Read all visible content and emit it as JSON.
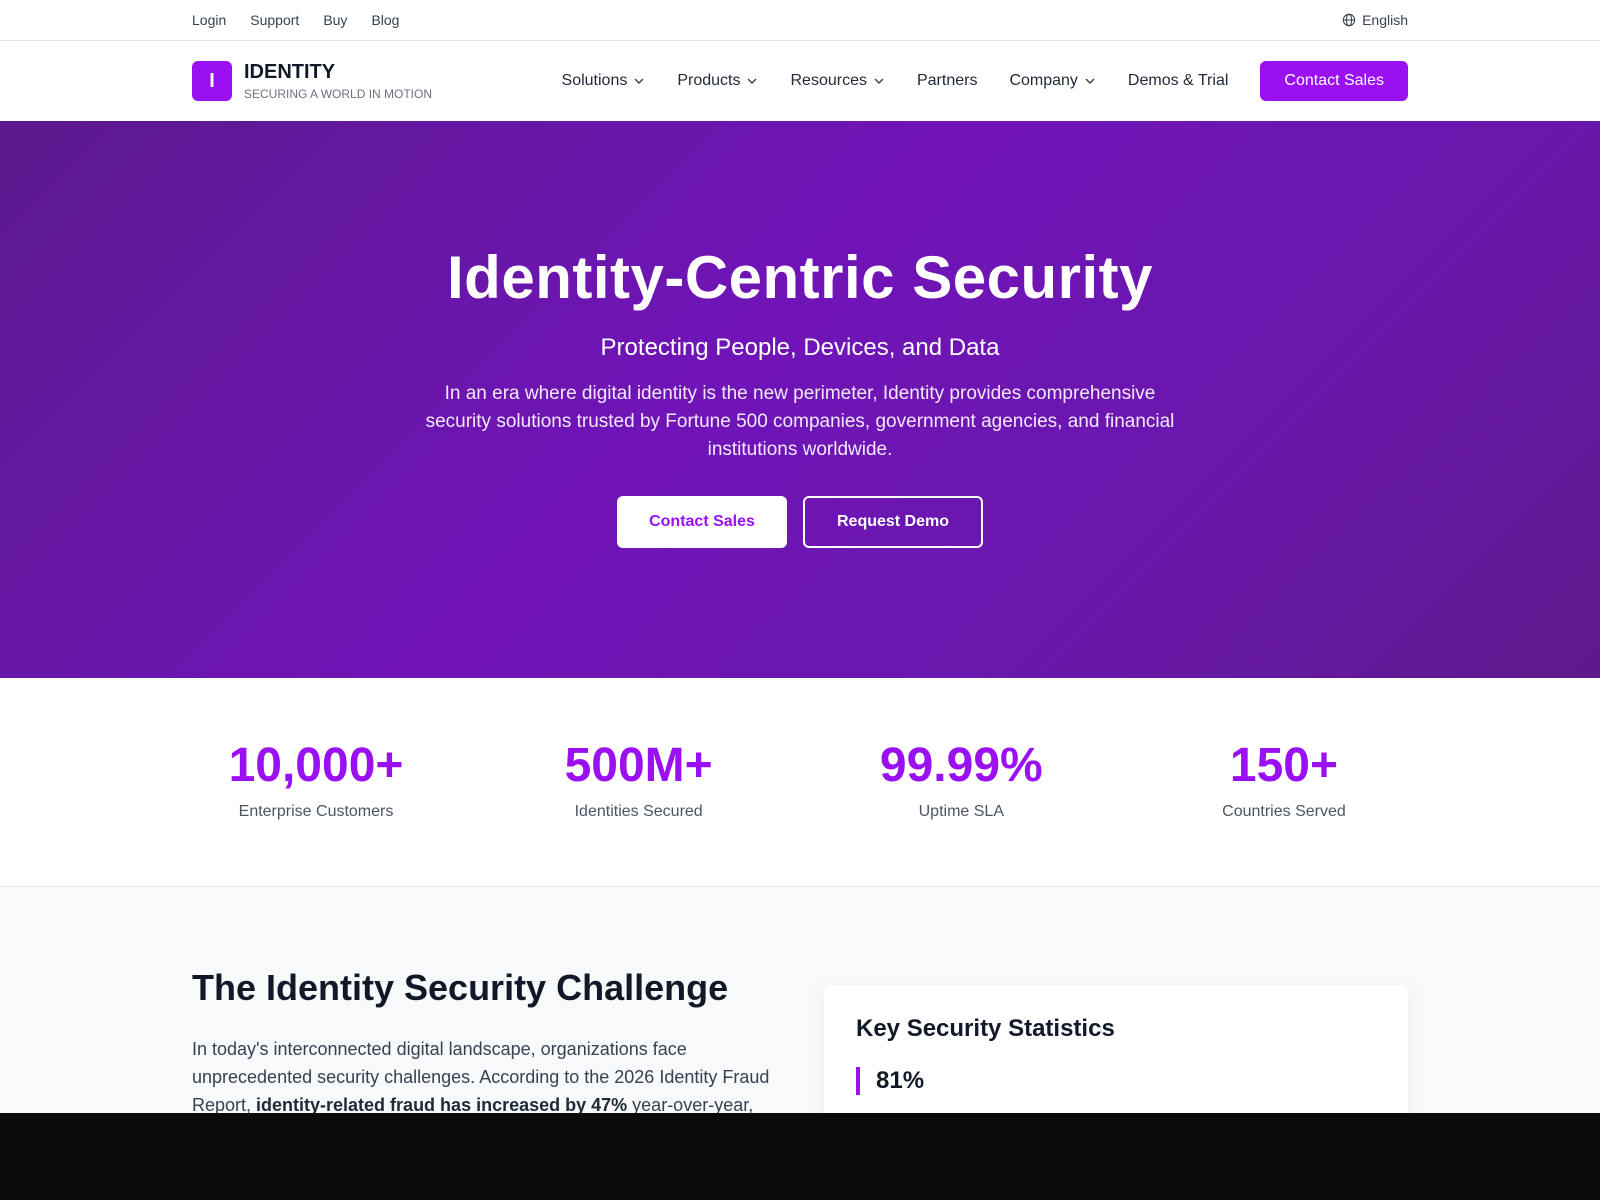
{
  "topbar": {
    "links": [
      "Login",
      "Support",
      "Buy",
      "Blog"
    ],
    "language": "English"
  },
  "brand": {
    "mark": "I",
    "name": "IDENTITY",
    "tagline": "SECURING A WORLD IN MOTION"
  },
  "nav": {
    "items": [
      {
        "label": "Solutions",
        "dropdown": true
      },
      {
        "label": "Products",
        "dropdown": true
      },
      {
        "label": "Resources",
        "dropdown": true
      },
      {
        "label": "Partners",
        "dropdown": false
      },
      {
        "label": "Company",
        "dropdown": true
      },
      {
        "label": "Demos & Trial",
        "dropdown": false
      }
    ],
    "cta": "Contact Sales"
  },
  "hero": {
    "title": "Identity-Centric Security",
    "subtitle": "Protecting People, Devices, and Data",
    "body": "In an era where digital identity is the new perimeter, Identity provides comprehensive security solutions trusted by Fortune 500 companies, government agencies, and financial institutions worldwide.",
    "primary_button": "Contact Sales",
    "secondary_button": "Request Demo"
  },
  "stats": [
    {
      "value": "10,000+",
      "label": "Enterprise Customers"
    },
    {
      "value": "500M+",
      "label": "Identities Secured"
    },
    {
      "value": "99.99%",
      "label": "Uptime SLA"
    },
    {
      "value": "150+",
      "label": "Countries Served"
    }
  ],
  "challenge": {
    "heading": "The Identity Security Challenge",
    "body_start": "In today's interconnected digital landscape, organizations face unprecedented security challenges. According to the 2026 Identity Fraud Report, ",
    "body_bold": "identity-related fraud has increased by 47%",
    "body_end": " year-over-year,"
  },
  "key_stats_card": {
    "title": "Key Security Statistics",
    "first_stat_value": "81%"
  },
  "colors": {
    "accent": "#9a10f2",
    "hero_dark": "#5b1a8e",
    "hero_mid": "#7014b8"
  }
}
